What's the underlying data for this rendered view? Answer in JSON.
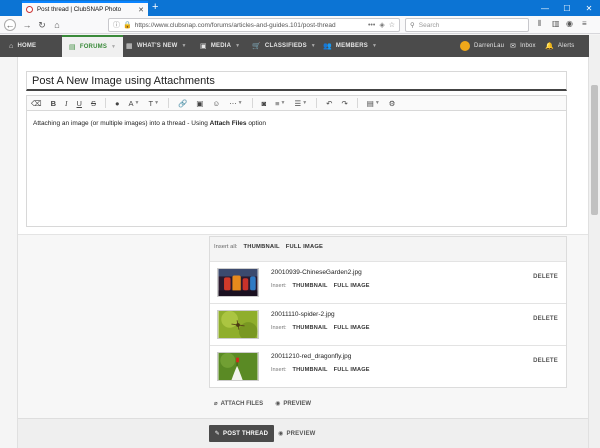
{
  "browser": {
    "tab_title": "Post thread | ClubSNAP Photo",
    "url": "https://www.clubsnap.com/forums/articles-and-guides.101/post-thread",
    "search_placeholder": "Search"
  },
  "sitenav": {
    "items": [
      {
        "label": "HOME",
        "icon": "home-icon"
      },
      {
        "label": "FORUMS",
        "icon": "forum-icon"
      },
      {
        "label": "WHAT'S NEW",
        "icon": "news-icon"
      },
      {
        "label": "MEDIA",
        "icon": "image-icon"
      },
      {
        "label": "CLASSIFIEDS",
        "icon": "cart-icon"
      },
      {
        "label": "MEMBERS",
        "icon": "members-icon"
      }
    ],
    "username": "DarrenLau",
    "inbox": "Inbox",
    "alerts": "Alerts"
  },
  "form": {
    "title_value": "Post A New Image using Attachments",
    "body_prefix": "Attaching an image (or multiple images) into a thread - Using ",
    "body_bold": "Attach Files",
    "body_suffix": " option"
  },
  "attachments": {
    "insert_all_label": "Insert all:",
    "thumbnail_label": "THUMBNAIL",
    "full_image_label": "FULL IMAGE",
    "insert_label": "Insert:",
    "delete_label": "DELETE",
    "files": [
      {
        "name": "20010939-ChineseGarden2.jpg"
      },
      {
        "name": "20011110-spider-2.jpg"
      },
      {
        "name": "20011210-red_dragonfly.jpg"
      }
    ]
  },
  "actions": {
    "attach_files": "ATTACH FILES",
    "preview": "PREVIEW",
    "post_thread": "POST THREAD",
    "preview_bottom": "PREVIEW"
  },
  "colors": {
    "nav_bg": "#4b4b4b",
    "accent_green": "#3a8a3a",
    "tabstrip_blue": "#0c74d4"
  }
}
